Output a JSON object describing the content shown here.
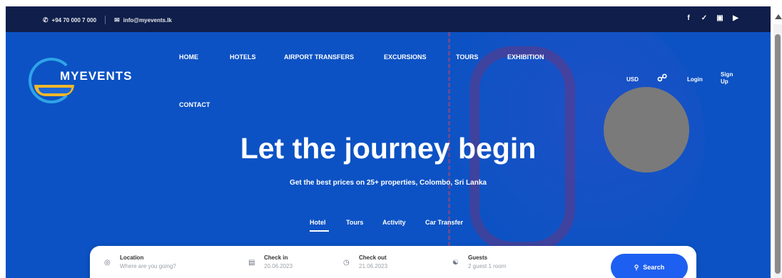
{
  "topbar": {
    "phone": "+94 70 000 7 000",
    "email": "info@myevents.lk",
    "phone_icon": "phone-icon",
    "email_icon": "mail-icon",
    "socials": [
      "facebook-icon",
      "twitter-icon",
      "instagram-icon",
      "youtube-icon"
    ]
  },
  "logo": {
    "text": "MYEVENTS"
  },
  "nav": {
    "items": [
      "HOME",
      "HOTELS",
      "AIRPORT TRANSFERS",
      "EXCURSIONS",
      "TOURS",
      "EXHIBITION",
      "CONTACT"
    ]
  },
  "tools": {
    "currency": "USD",
    "login": "Login",
    "signup": "Sign Up"
  },
  "hero": {
    "title": "Let the journey begin",
    "subtitle": "Get the best prices on 25+ properties, Colombo, Sri Lanka"
  },
  "tabs": {
    "items": [
      "Hotel",
      "Tours",
      "Activity",
      "Car Transfer"
    ],
    "active": "Hotel"
  },
  "search": {
    "location_label": "Location",
    "location_value": "Where are you going?",
    "checkin_label": "Check in",
    "checkin_value": "20.06.2023",
    "checkout_label": "Check out",
    "checkout_value": "21.06.2023",
    "guests_label": "Guests",
    "guests_value": "2 guest 1 room",
    "button": "Search"
  },
  "colors": {
    "hero_bg": "#0c52c4",
    "topbar_bg": "#0f1e4a",
    "accent": "#1d5ff0"
  }
}
